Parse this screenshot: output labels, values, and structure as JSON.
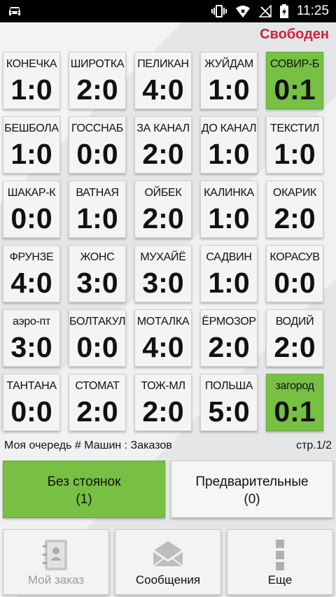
{
  "statusbar": {
    "time": "11:25",
    "icons": [
      "car-icon",
      "vibrate-icon",
      "wifi-icon",
      "no-signal-icon",
      "battery-charging-icon"
    ]
  },
  "status_text": "Свободен",
  "tiles": [
    {
      "name": "КОНЕЧКА",
      "score": "1:0",
      "highlight": false
    },
    {
      "name": "ШИРОТКА",
      "score": "2:0",
      "highlight": false
    },
    {
      "name": "ПЕЛИКАН",
      "score": "4:0",
      "highlight": false
    },
    {
      "name": "ЖУЙДАМ",
      "score": "1:0",
      "highlight": false
    },
    {
      "name": "СОВИР-Б",
      "score": "0:1",
      "highlight": true
    },
    {
      "name": "БЕШБОЛА",
      "score": "1:0",
      "highlight": false
    },
    {
      "name": "ГОССНАБ",
      "score": "0:0",
      "highlight": false
    },
    {
      "name": "ЗА КАНАЛ",
      "score": "2:0",
      "highlight": false
    },
    {
      "name": "ДО КАНАЛ",
      "score": "1:0",
      "highlight": false
    },
    {
      "name": "ТЕКСТИЛ",
      "score": "1:0",
      "highlight": false
    },
    {
      "name": "ШАКАР-К",
      "score": "0:0",
      "highlight": false
    },
    {
      "name": "ВАТНАЯ",
      "score": "1:0",
      "highlight": false
    },
    {
      "name": "ОЙБЕК",
      "score": "2:0",
      "highlight": false
    },
    {
      "name": "КАЛИНКА",
      "score": "1:0",
      "highlight": false
    },
    {
      "name": "ОКАРИК",
      "score": "2:0",
      "highlight": false
    },
    {
      "name": "ФРУНЗЕ",
      "score": "4:0",
      "highlight": false
    },
    {
      "name": "ЖОНС",
      "score": "3:0",
      "highlight": false
    },
    {
      "name": "МУХАЙЁ",
      "score": "3:0",
      "highlight": false
    },
    {
      "name": "САДВИН",
      "score": "1:0",
      "highlight": false
    },
    {
      "name": "КОРАСУВ",
      "score": "0:0",
      "highlight": false
    },
    {
      "name": "аэро-пт",
      "score": "3:0",
      "highlight": false
    },
    {
      "name": "БОЛТАКУЛ",
      "score": "0:0",
      "highlight": false
    },
    {
      "name": "МОТАЛКА",
      "score": "4:0",
      "highlight": false
    },
    {
      "name": "ЁРМОЗОР",
      "score": "2:0",
      "highlight": false
    },
    {
      "name": "ВОДИЙ",
      "score": "2:0",
      "highlight": false
    },
    {
      "name": "ТАНТАНА",
      "score": "0:0",
      "highlight": false
    },
    {
      "name": "СТОМАТ",
      "score": "2:0",
      "highlight": false
    },
    {
      "name": "ТОЖ-МЛ",
      "score": "2:0",
      "highlight": false
    },
    {
      "name": "ПОЛЬША",
      "score": "5:0",
      "highlight": false
    },
    {
      "name": "загород",
      "score": "0:1",
      "highlight": true
    }
  ],
  "queue_label": "Моя очередь # Машин : Заказов",
  "page_label": "стр.1/2",
  "buttons": {
    "no_stand": {
      "label": "Без стоянок",
      "count": "(1)"
    },
    "preliminary": {
      "label": "Предварительные",
      "count": "(0)"
    }
  },
  "bottom_nav": {
    "my_order": {
      "label": "Мой заказ",
      "icon": "contacts-book-icon"
    },
    "messages": {
      "label": "Сообщения",
      "icon": "envelope-icon"
    },
    "more": {
      "label": "Еще",
      "icon": "more-dots-icon"
    }
  },
  "colors": {
    "green": "#77c043",
    "status_red": "#d3223a",
    "tile": "#f4f4f4"
  }
}
